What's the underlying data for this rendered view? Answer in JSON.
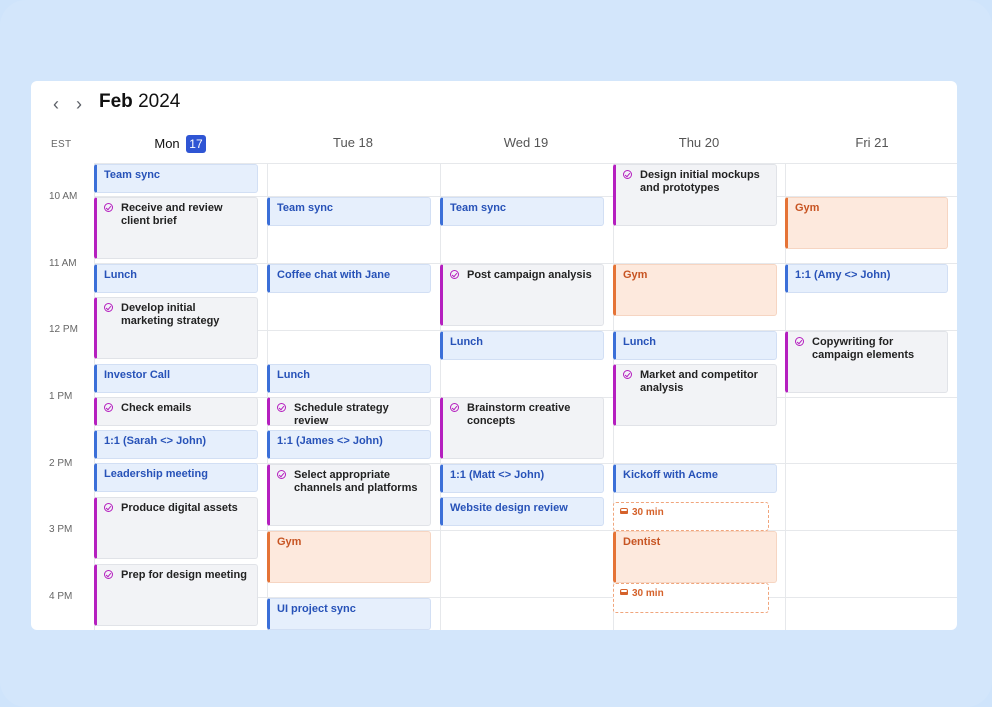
{
  "header": {
    "month_bold": "Feb",
    "year": "2024",
    "timezone": "EST"
  },
  "days": [
    {
      "label": "Mon",
      "badge": "17",
      "today": true
    },
    {
      "label": "Tue 18"
    },
    {
      "label": "Wed 19"
    },
    {
      "label": "Thu 20"
    },
    {
      "label": "Fri 21"
    }
  ],
  "times": [
    "10 AM",
    "11 AM",
    "12 PM",
    "1 PM",
    "2 PM",
    "3 PM",
    "4 PM"
  ],
  "colors": {
    "accent": "#2f55d4",
    "task": "#b51fbf",
    "event": "#3b6fd8",
    "personal": "#e57336",
    "background": "#d3e6fb"
  },
  "events": {
    "mon": [
      {
        "title": "Team sync",
        "type": "blue"
      },
      {
        "title": "Receive and review client brief",
        "type": "task"
      },
      {
        "title": "Lunch",
        "type": "blue"
      },
      {
        "title": "Develop initial marketing strategy",
        "type": "task"
      },
      {
        "title": "Investor Call",
        "type": "blue"
      },
      {
        "title": "Check emails",
        "type": "task"
      },
      {
        "title": "1:1 (Sarah <> John)",
        "type": "blue"
      },
      {
        "title": "Leadership meeting",
        "type": "blue"
      },
      {
        "title": "Produce digital assets",
        "type": "task"
      },
      {
        "title": "Prep for design meeting",
        "type": "task"
      }
    ],
    "tue": [
      {
        "title": "Team sync",
        "type": "blue"
      },
      {
        "title": "Coffee chat with Jane",
        "type": "blue"
      },
      {
        "title": "Lunch",
        "type": "blue"
      },
      {
        "title": "Schedule strategy review",
        "type": "task"
      },
      {
        "title": "1:1 (James <> John)",
        "type": "blue"
      },
      {
        "title": "Select appropriate channels and platforms",
        "type": "task"
      },
      {
        "title": "Gym",
        "type": "orange"
      },
      {
        "title": "UI project sync",
        "type": "blue"
      }
    ],
    "wed": [
      {
        "title": "Team sync",
        "type": "blue"
      },
      {
        "title": "Post campaign analysis",
        "type": "task"
      },
      {
        "title": "Lunch",
        "type": "blue"
      },
      {
        "title": "Brainstorm creative concepts",
        "type": "task"
      },
      {
        "title": "1:1 (Matt <> John)",
        "type": "blue"
      },
      {
        "title": "Website design review",
        "type": "blue"
      }
    ],
    "thu": [
      {
        "title": "Design initial mockups and prototypes",
        "type": "task"
      },
      {
        "title": "Gym",
        "type": "orange"
      },
      {
        "title": "Lunch",
        "type": "blue"
      },
      {
        "title": "Market and competitor analysis",
        "type": "task"
      },
      {
        "title": "Kickoff with Acme",
        "type": "blue"
      },
      {
        "title": "30 min",
        "type": "travel"
      },
      {
        "title": "Dentist",
        "type": "orange"
      },
      {
        "title": "30 min",
        "type": "travel"
      }
    ],
    "fri": [
      {
        "title": "Gym",
        "type": "orange"
      },
      {
        "title": "1:1 (Amy <> John)",
        "type": "blue"
      },
      {
        "title": "Copywriting for campaign elements",
        "type": "task"
      }
    ]
  }
}
